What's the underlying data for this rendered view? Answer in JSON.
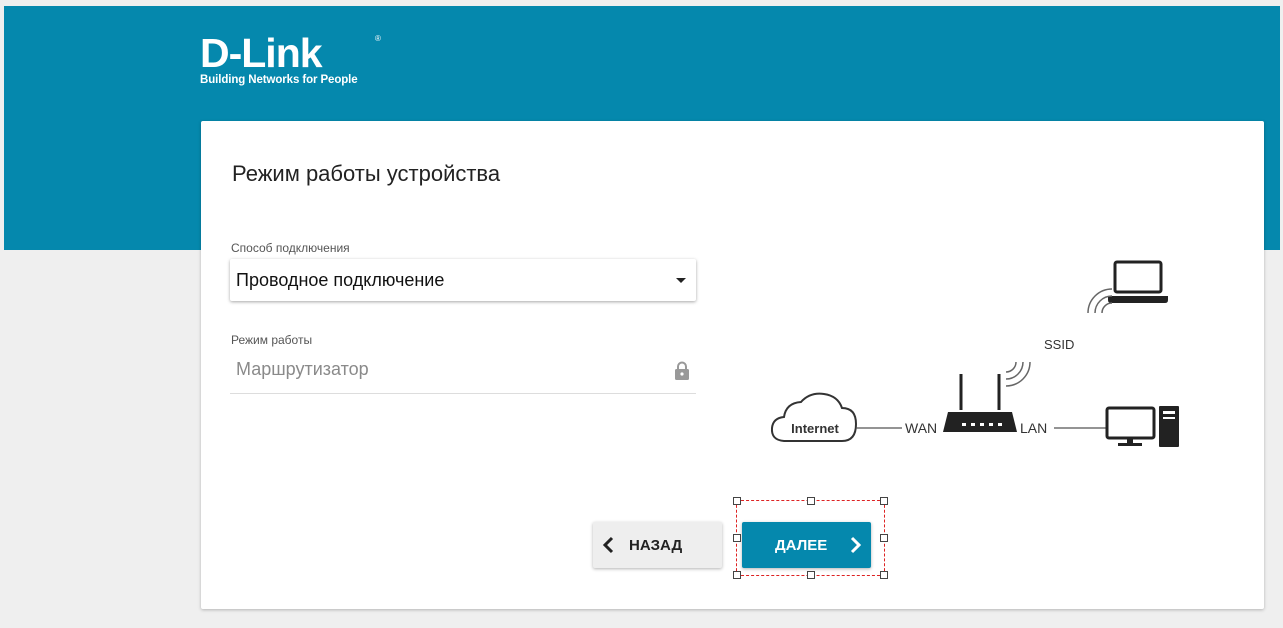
{
  "brand": {
    "name": "D-Link",
    "registered": "®",
    "tagline": "Building Networks for People"
  },
  "page": {
    "title": "Режим работы устройства"
  },
  "form": {
    "connection_label": "Способ подключения",
    "connection_value": "Проводное подключение",
    "mode_label": "Режим работы",
    "mode_value": "Маршрутизатор"
  },
  "diagram": {
    "internet": "Internet",
    "wan": "WAN",
    "lan": "LAN",
    "ssid": "SSID"
  },
  "buttons": {
    "back": "НАЗАД",
    "next": "ДАЛЕЕ"
  },
  "colors": {
    "brand_blue": "#0588ad",
    "selection": "#dd2222"
  }
}
